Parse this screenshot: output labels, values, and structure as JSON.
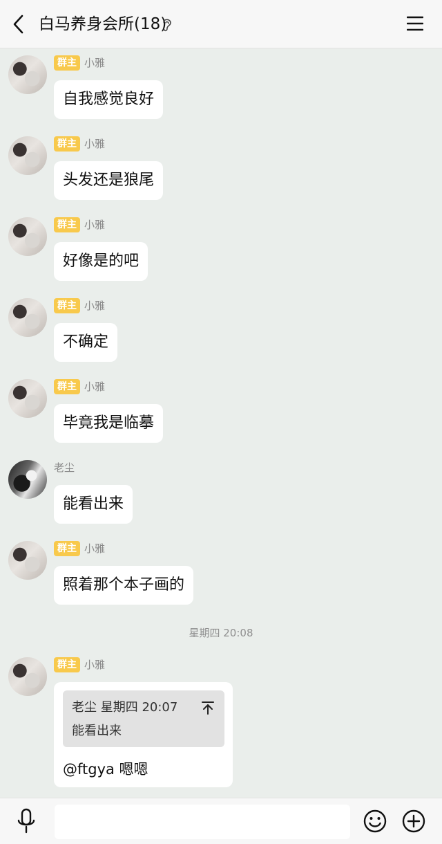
{
  "header": {
    "title": "白马养身会所(18)"
  },
  "messages": [
    {
      "badge": "群主",
      "sender": "小雅",
      "text": "自我感觉良好"
    },
    {
      "badge": "群主",
      "sender": "小雅",
      "text": "头发还是狼尾"
    },
    {
      "badge": "群主",
      "sender": "小雅",
      "text": "好像是的吧"
    },
    {
      "badge": "群主",
      "sender": "小雅",
      "text": "不确定"
    },
    {
      "badge": "群主",
      "sender": "小雅",
      "text": "毕竟我是临摹"
    },
    {
      "sender": "老尘",
      "text": "能看出来"
    },
    {
      "badge": "群主",
      "sender": "小雅",
      "text": "照着那个本子画的"
    }
  ],
  "timestamp": "星期四 20:08",
  "reply_message": {
    "badge": "群主",
    "sender": "小雅",
    "quote_header": "老尘 星期四 20:07",
    "quote_text": "能看出来",
    "text": "@ftgya 嗯嗯"
  },
  "input": {
    "value": "",
    "placeholder": ""
  },
  "icons": {
    "back": "back-arrow-icon",
    "ear": "ear-icon",
    "menu": "menu-icon",
    "mic": "microphone-icon",
    "emoji": "emoji-icon",
    "plus": "plus-icon",
    "jump": "jump-to-original-icon"
  },
  "colors": {
    "background": "#eaeeeb",
    "badge": "#f8c94c",
    "bubble": "#ffffff",
    "quote": "#e2e2e2"
  }
}
